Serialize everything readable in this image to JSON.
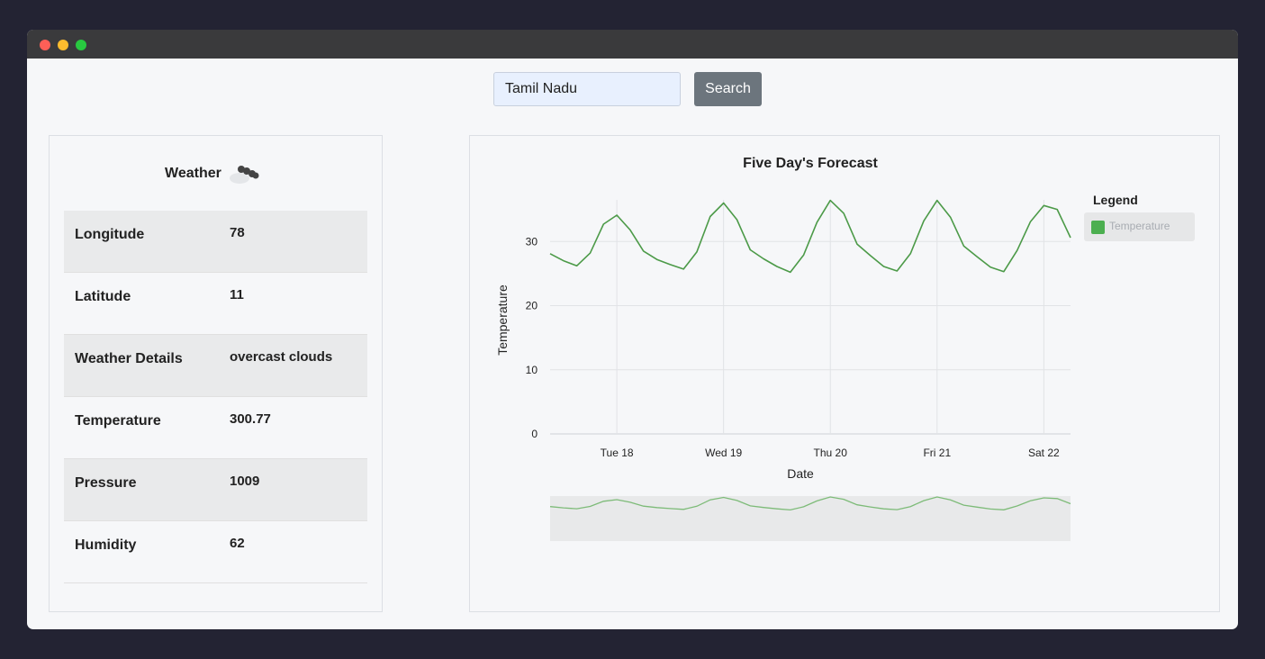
{
  "window": {
    "controls": [
      "close",
      "minimize",
      "maximize"
    ]
  },
  "search": {
    "value": "Tamil Nadu",
    "button_label": "Search"
  },
  "info": {
    "title": "Weather",
    "icon": "overcast-clouds-icon",
    "rows": [
      {
        "label": "Longitude",
        "value": "78"
      },
      {
        "label": "Latitude",
        "value": "11"
      },
      {
        "label": "Weather Details",
        "value": "overcast clouds"
      },
      {
        "label": "Temperature",
        "value": "300.77"
      },
      {
        "label": "Pressure",
        "value": "1009"
      },
      {
        "label": "Humidity",
        "value": "62"
      }
    ]
  },
  "chart_data": {
    "type": "line",
    "title": "Five Day's Forecast",
    "xlabel": "Date",
    "ylabel": "Temperature",
    "ylim": [
      0,
      40
    ],
    "yticks": [
      0,
      10,
      20,
      30
    ],
    "xticks": [
      "Tue 18",
      "Wed 19",
      "Thu 20",
      "Fri 21",
      "Sat 22"
    ],
    "grid": true,
    "legend": {
      "title": "Legend",
      "position": "right"
    },
    "brush": true,
    "series": [
      {
        "name": "Temperature",
        "color": "#4c9a48",
        "values": [
          28.1,
          27.0,
          26.2,
          28.2,
          32.7,
          34.1,
          31.8,
          28.5,
          27.2,
          26.4,
          25.7,
          28.4,
          33.9,
          36.0,
          33.4,
          28.7,
          27.3,
          26.1,
          25.2,
          27.9,
          33.0,
          36.4,
          34.4,
          29.6,
          27.8,
          26.1,
          25.4,
          28.1,
          33.2,
          36.4,
          33.8,
          29.3,
          27.6,
          26.0,
          25.3,
          28.6,
          33.1,
          35.6,
          35.0,
          30.6
        ]
      }
    ]
  }
}
